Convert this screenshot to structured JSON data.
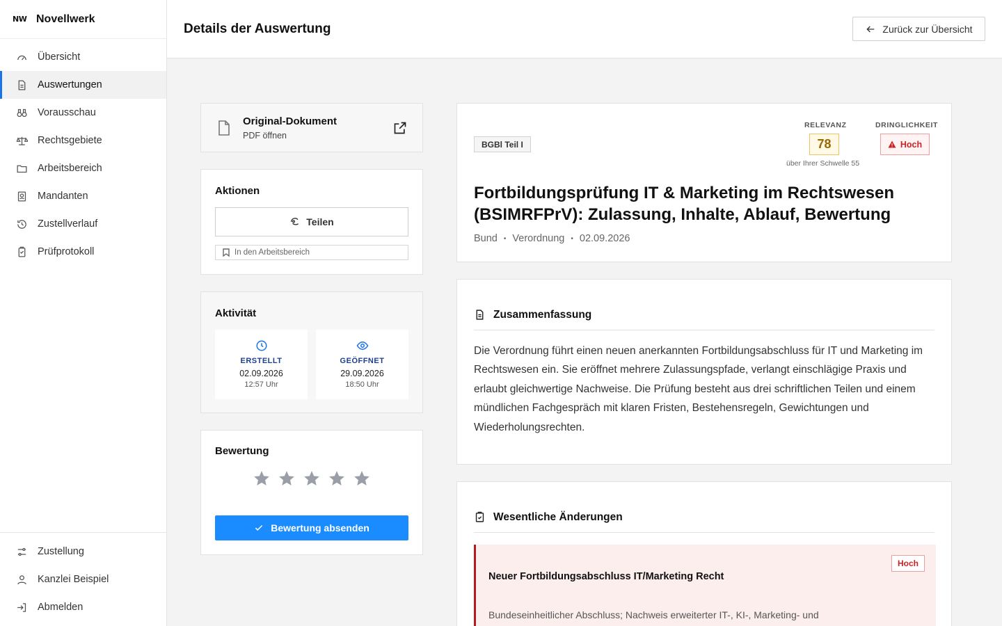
{
  "app": {
    "logo": "NW",
    "name": "Novellwerk"
  },
  "sidebar": {
    "items": [
      {
        "label": "Übersicht",
        "icon": "gauge-icon"
      },
      {
        "label": "Auswertungen",
        "icon": "document-icon",
        "active": true
      },
      {
        "label": "Vorausschau",
        "icon": "binoculars-icon"
      },
      {
        "label": "Rechtsgebiete",
        "icon": "scale-icon"
      },
      {
        "label": "Arbeitsbereich",
        "icon": "folder-icon"
      },
      {
        "label": "Mandanten",
        "icon": "contact-icon"
      },
      {
        "label": "Zustellverlauf",
        "icon": "history-icon"
      },
      {
        "label": "Prüfprotokoll",
        "icon": "clipboard-icon"
      }
    ],
    "bottom": [
      {
        "label": "Zustellung",
        "icon": "sliders-icon"
      },
      {
        "label": "Kanzlei Beispiel",
        "icon": "user-icon"
      },
      {
        "label": "Abmelden",
        "icon": "logout-icon"
      }
    ]
  },
  "header": {
    "title": "Details der Auswertung",
    "back_label": "Zurück zur Übersicht"
  },
  "document": {
    "title": "Original-Dokument",
    "subtitle": "PDF öffnen"
  },
  "actions": {
    "title": "Aktionen",
    "share_label": "Teilen",
    "workspace_label": "In den Arbeitsbereich"
  },
  "activity": {
    "title": "Aktivität",
    "created": {
      "label": "ERSTELLT",
      "date": "02.09.2026",
      "time": "12:57 Uhr"
    },
    "opened": {
      "label": "GEÖFFNET",
      "date": "29.09.2026",
      "time": "18:50 Uhr"
    }
  },
  "rating": {
    "title": "Bewertung",
    "max_stars": 5,
    "selected_stars": 0,
    "submit_label": "Bewertung absenden"
  },
  "detail": {
    "source": "BGBl Teil I",
    "relevance_label": "RELEVANZ",
    "relevance_value": "78",
    "relevance_note": "über Ihrer Schwelle 55",
    "urgency_label": "DRINGLICHKEIT",
    "urgency_value": "Hoch",
    "title": "Fortbildungsprüfung IT & Marketing im Rechtswesen (BSIMRFPrV): Zulassung, Inhalte, Ablauf, Bewertung",
    "meta": {
      "scope": "Bund",
      "type": "Verordnung",
      "date": "02.09.2026"
    }
  },
  "summary": {
    "heading": "Zusammenfassung",
    "text": "Die Verordnung führt einen neuen anerkannten Fortbildungsabschluss für IT und Marketing im Rechtswesen ein. Sie eröffnet mehrere Zulassungspfade, verlangt einschlägige Praxis und erlaubt gleichwertige Nachweise. Die Prüfung besteht aus drei schriftlichen Teilen und einem mündlichen Fachgespräch mit klaren Fristen, Bestehensregeln, Gewichtungen und Wiederholungsrechten."
  },
  "changes": {
    "heading": "Wesentliche Änderungen",
    "items": [
      {
        "title": "Neuer Fortbildungsabschluss IT/Marketing Recht",
        "priority": "Hoch",
        "text": "Bundeseinheitlicher Abschluss; Nachweis erweiterter IT-, KI-, Marketing- und"
      }
    ]
  },
  "colors": {
    "accent": "#1a8cff",
    "urgency": "#cc2222",
    "relevance": "#9a6a00"
  }
}
